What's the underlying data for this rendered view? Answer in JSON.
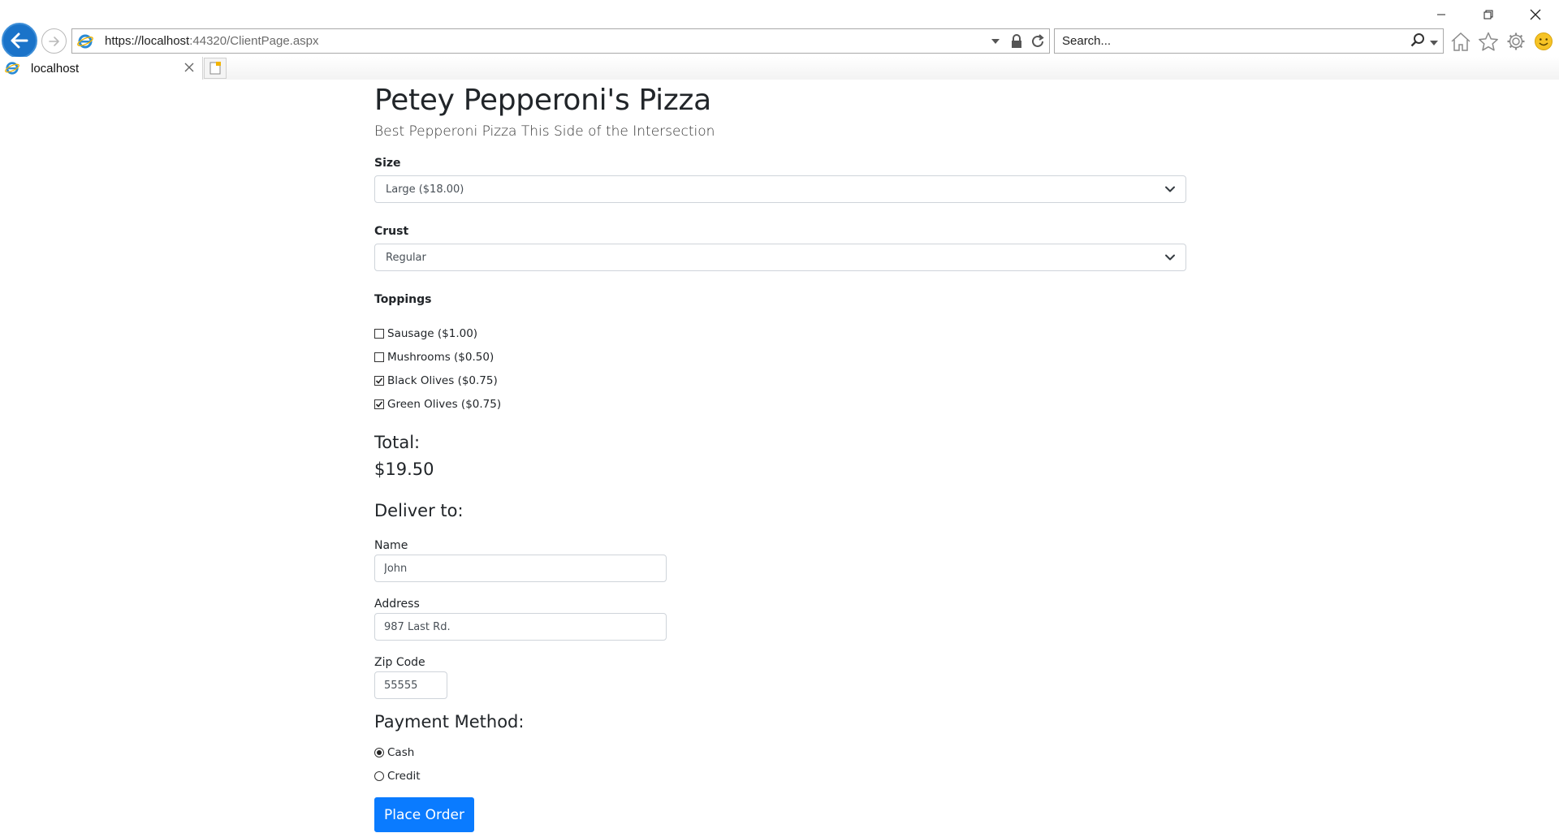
{
  "browser": {
    "url_host": "https://localhost",
    "url_path": ":44320/ClientPage.aspx",
    "search_placeholder": "Search...",
    "tab_title": "localhost",
    "accent": "#1a73c9"
  },
  "page": {
    "title": "Petey Pepperoni's Pizza",
    "subtitle": "Best Pepperoni Pizza This Side of the Intersection",
    "size": {
      "label": "Size",
      "selected": "Large ($18.00)"
    },
    "crust": {
      "label": "Crust",
      "selected": "Regular"
    },
    "toppings": {
      "label": "Toppings",
      "items": [
        {
          "label": "Sausage ($1.00)",
          "checked": false
        },
        {
          "label": "Mushrooms ($0.50)",
          "checked": false
        },
        {
          "label": "Black Olives ($0.75)",
          "checked": true
        },
        {
          "label": "Green Olives ($0.75)",
          "checked": true
        }
      ]
    },
    "total": {
      "label": "Total:",
      "value": "$19.50"
    },
    "delivery": {
      "heading": "Deliver to:",
      "name": {
        "label": "Name",
        "value": "John"
      },
      "address": {
        "label": "Address",
        "value": "987 Last Rd."
      },
      "zip": {
        "label": "Zip Code",
        "value": "55555"
      }
    },
    "payment": {
      "heading": "Payment Method:",
      "options": [
        {
          "label": "Cash",
          "selected": true
        },
        {
          "label": "Credit",
          "selected": false
        }
      ]
    },
    "submit_label": "Place Order",
    "button_color": "#0a7bff"
  }
}
